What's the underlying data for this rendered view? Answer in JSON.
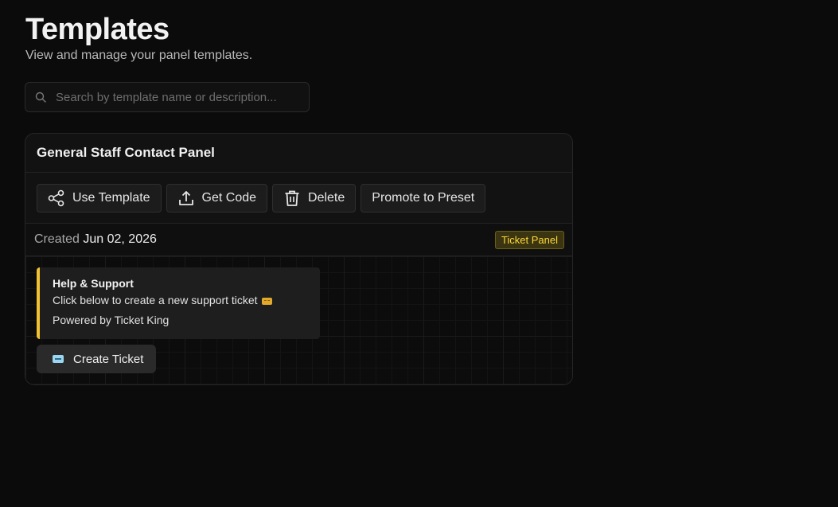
{
  "header": {
    "title": "Templates",
    "subtitle": "View and manage your panel templates."
  },
  "search": {
    "placeholder": "Search by template name or description...",
    "value": ""
  },
  "template_card": {
    "name": "General Staff Contact Panel",
    "actions": {
      "use_template": "Use Template",
      "get_code": "Get Code",
      "delete": "Delete",
      "promote": "Promote to Preset"
    },
    "created_label": "Created",
    "created_date": "Jun 02, 2026",
    "type_badge": "Ticket Panel",
    "preview": {
      "embed_title": "Help & Support",
      "embed_description": "Click below to create a new support ticket",
      "embed_footer": "Powered by Ticket King",
      "button_label": "Create Ticket",
      "embed_color": "#f1c232"
    }
  },
  "icons": [
    "search-icon",
    "share-icon",
    "upload-icon",
    "trash-icon",
    "ticket-icon"
  ]
}
